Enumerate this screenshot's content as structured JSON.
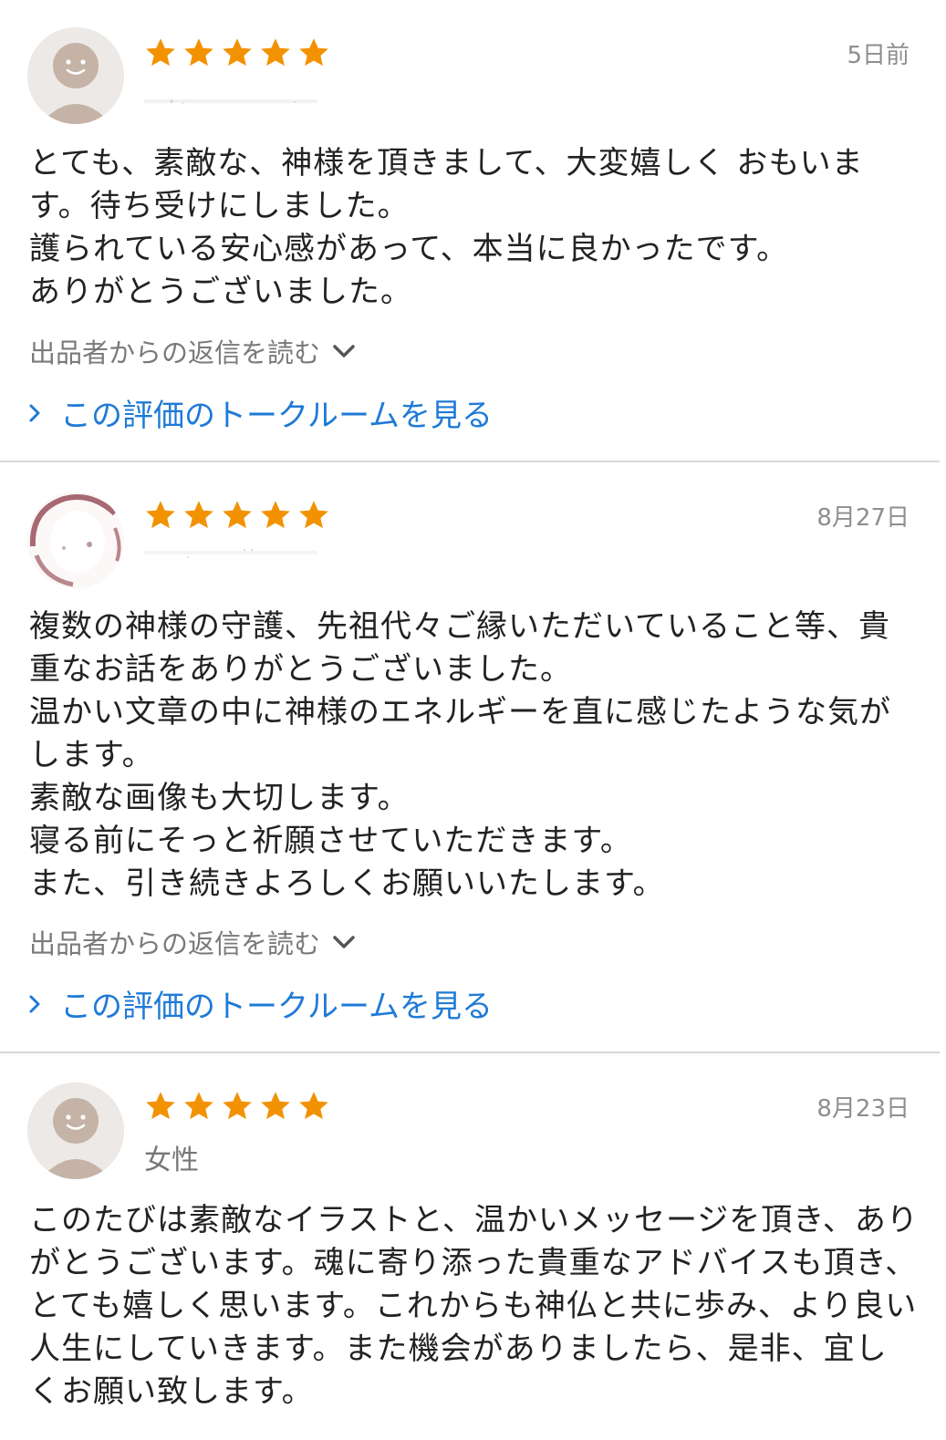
{
  "colors": {
    "star": "#f39200",
    "link": "#1f7ad6",
    "divider": "#d8d8d8",
    "date": "#8e8e8e"
  },
  "icons": {
    "star": "star-icon",
    "reply_toggle": "chevron-down-icon",
    "talk_link": "chevron-right-icon",
    "avatar_default": "default-avatar-icon"
  },
  "reviews": [
    {
      "rating": 5,
      "date": "5日前",
      "username": "",
      "body": "とても、素敵な、神様を頂きまして、大変嬉しく おもいます。待ち受けにしました。\n護られている安心感があって、本当に良かったです。\nありがとうございました。",
      "reply_label": "出品者からの返信を読む",
      "talk_label": "この評価のトークルームを見る"
    },
    {
      "rating": 5,
      "date": "8月27日",
      "username": "",
      "body": "複数の神様の守護、先祖代々ご縁いただいていること等、貴重なお話をありがとうございました。\n温かい文章の中に神様のエネルギーを直に感じたような気がします。\n素敵な画像も大切します。\n寝る前にそっと祈願させていただきます。\nまた、引き続きよろしくお願いいたします。",
      "reply_label": "出品者からの返信を読む",
      "talk_label": "この評価のトークルームを見る"
    },
    {
      "rating": 5,
      "date": "8月23日",
      "username": "女性",
      "body": "このたびは素敵なイラストと、温かいメッセージを頂き、ありがとうございます。魂に寄り添った貴重なアドバイスも頂き、とても嬉しく思います。これからも神仏と共に歩み、より良い人生にしていきます。また機会がありましたら、是非、宜しくお願い致します。"
    }
  ]
}
